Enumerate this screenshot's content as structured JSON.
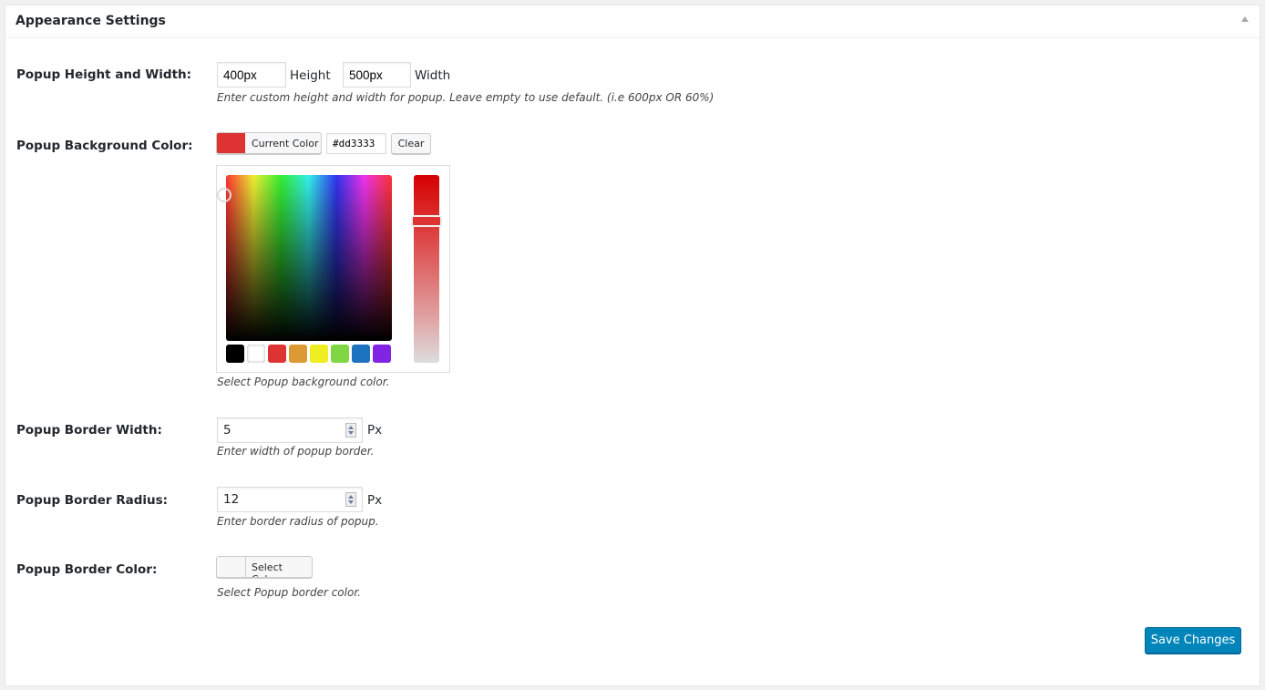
{
  "header": {
    "title": "Appearance Settings"
  },
  "size": {
    "label": "Popup Height and Width:",
    "height_value": "400px",
    "height_label": "Height",
    "width_value": "500px",
    "width_label": "Width",
    "description": "Enter custom height and width for popup. Leave empty to use default. (i.e 600px OR 60%)"
  },
  "bg_color": {
    "label": "Popup Background Color:",
    "button_label": "Current Color",
    "hex_value": "#dd3333",
    "clear_label": "Clear",
    "description": "Select Popup background color.",
    "current": "#dd3333",
    "swatches": [
      "#000000",
      "#ffffff",
      "#dd3333",
      "#dd9933",
      "#eeee22",
      "#81d742",
      "#1e73be",
      "#8224e3"
    ]
  },
  "border_width": {
    "label": "Popup Border Width:",
    "value": "5",
    "unit": "Px",
    "description": "Enter width of popup border."
  },
  "border_radius": {
    "label": "Popup Border Radius:",
    "value": "12",
    "unit": "Px",
    "description": "Enter border radius of popup."
  },
  "border_color": {
    "label": "Popup Border Color:",
    "button_label": "Select Color",
    "description": "Select Popup border color."
  },
  "save_label": "Save Changes"
}
